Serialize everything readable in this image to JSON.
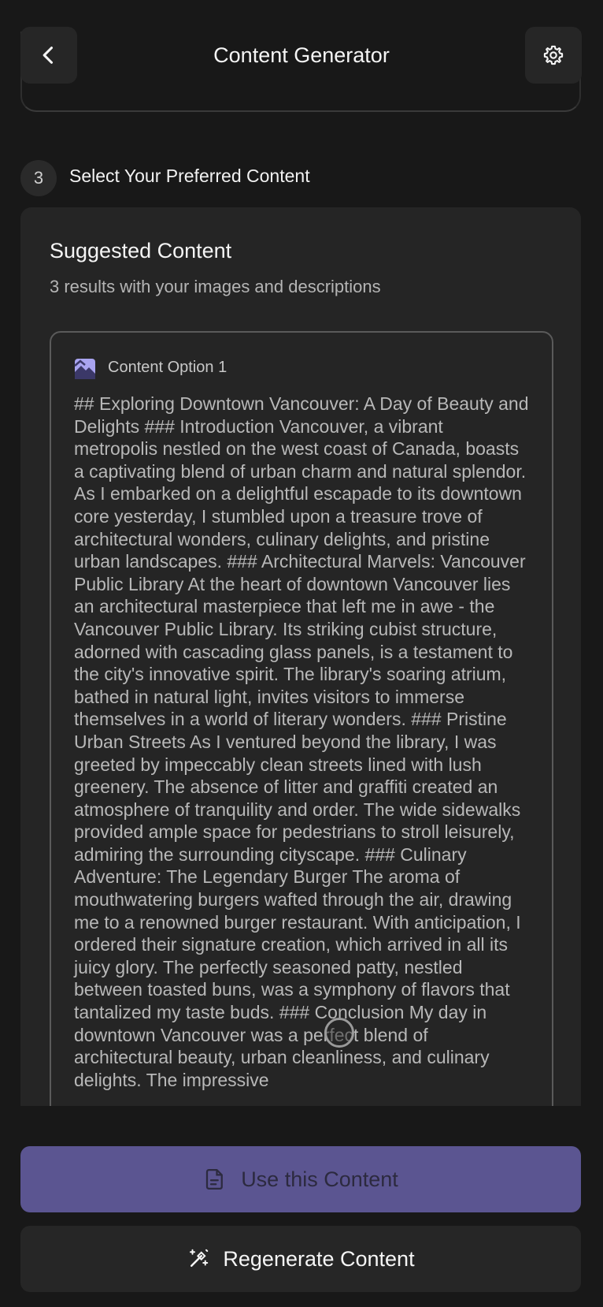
{
  "header": {
    "title": "Content Generator",
    "back_icon": "chevron-left-icon",
    "settings_icon": "gear-icon"
  },
  "step": {
    "number": "3",
    "title": "Select Your Preferred Content"
  },
  "suggested": {
    "title": "Suggested Content",
    "subtitle": "3 results with your images and descriptions",
    "options": [
      {
        "label": "Content Option 1",
        "icon": "content-option-icon",
        "text": "## Exploring Downtown Vancouver: A Day of Beauty and Delights ### Introduction Vancouver, a vibrant metropolis nestled on the west coast of Canada, boasts a captivating blend of urban charm and natural splendor. As I embarked on a delightful escapade to its downtown core yesterday, I stumbled upon a treasure trove of architectural wonders, culinary delights, and pristine urban landscapes. ### Architectural Marvels: Vancouver Public Library At the heart of downtown Vancouver lies an architectural masterpiece that left me in awe - the Vancouver Public Library. Its striking cubist structure, adorned with cascading glass panels, is a testament to the city's innovative spirit. The library's soaring atrium, bathed in natural light, invites visitors to immerse themselves in a world of literary wonders. ### Pristine Urban Streets As I ventured beyond the library, I was greeted by impeccably clean streets lined with lush greenery. The absence of litter and graffiti created an atmosphere of tranquility and order. The wide sidewalks provided ample space for pedestrians to stroll leisurely, admiring the surrounding cityscape. ### Culinary Adventure: The Legendary Burger The aroma of mouthwatering burgers wafted through the air, drawing me to a renowned burger restaurant. With anticipation, I ordered their signature creation, which arrived in all its juicy glory. The perfectly seasoned patty, nestled between toasted buns, was a symphony of flavors that tantalized my taste buds. ### Conclusion My day in downtown Vancouver was a perfect blend of architectural beauty, urban cleanliness, and culinary delights. The impressive"
      }
    ]
  },
  "actions": {
    "use_label": "Use this Content",
    "use_icon": "document-icon",
    "regenerate_label": "Regenerate Content",
    "regenerate_icon": "magic-wand-icon"
  },
  "colors": {
    "background": "#181818",
    "panel": "#252525",
    "accent": "#5b5591"
  }
}
